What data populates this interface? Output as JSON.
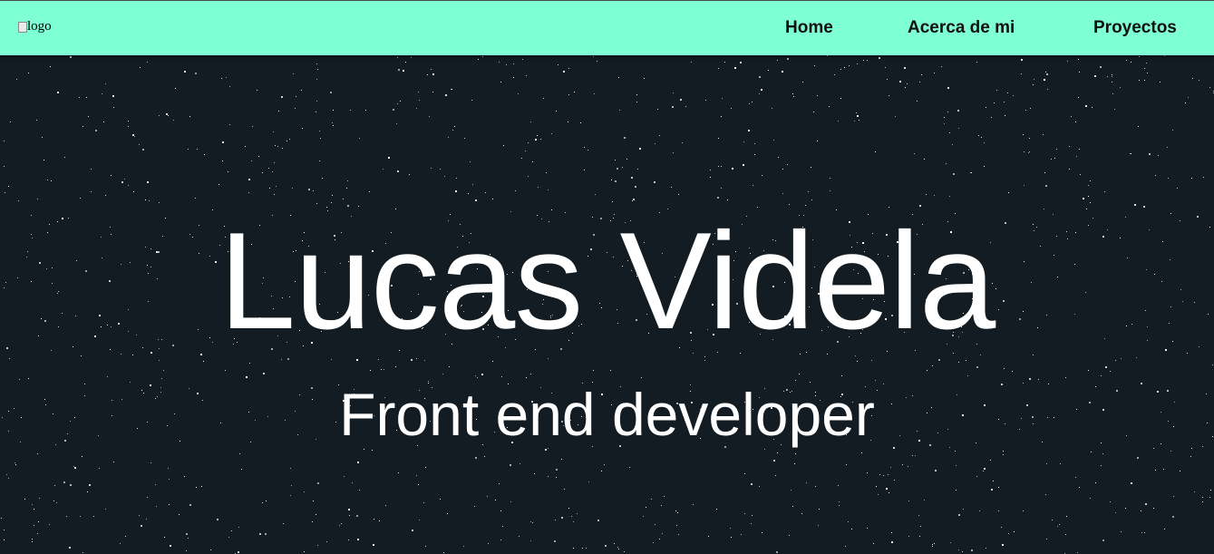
{
  "navbar": {
    "logo_alt": "logo",
    "links": {
      "home": "Home",
      "about": "Acerca de mi",
      "projects": "Proyectos"
    },
    "background_color": "#7fffd4"
  },
  "hero": {
    "title": "Lucas Videla",
    "subtitle": "Front end developer",
    "background_color": "#121c22",
    "text_color": "#ffffff"
  }
}
